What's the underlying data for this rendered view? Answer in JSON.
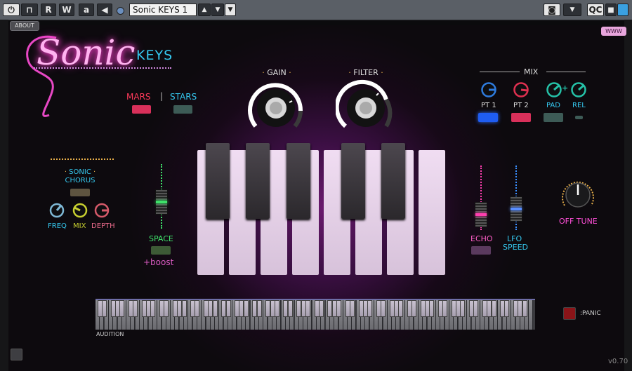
{
  "toolbar": {
    "r_label": "R",
    "w_label": "W",
    "a_label": "a",
    "preset_name": "Sonic KEYS 1",
    "qc_label": "QC"
  },
  "header": {
    "about_label": "ABOUT",
    "www_label": "WWW",
    "brand_script": "Sonic",
    "brand_keys": "KEYS"
  },
  "mode": {
    "mars": "MARS",
    "separator": "|",
    "stars": "STARS"
  },
  "knobs": {
    "gain": "GAIN",
    "filter": "FILTER"
  },
  "mix": {
    "title": "MIX",
    "pt1": "PT 1",
    "pt2": "PT 2",
    "pad": "PAD",
    "rel": "REL",
    "plus": "+"
  },
  "chorus": {
    "title_line1": "SONIC",
    "title_line2": "CHORUS",
    "freq": "FREQ",
    "mix": "MIX",
    "depth": "DEPTH"
  },
  "space": {
    "label": "SPACE",
    "boost": "+boost"
  },
  "echo": {
    "label": "ECHO"
  },
  "lfo": {
    "line1": "LFO",
    "line2": "SPEED"
  },
  "offtune": {
    "label": "OFF TUNE"
  },
  "footer": {
    "audition": "AUDITION",
    "panic": ":PANIC",
    "version": "v0.70"
  },
  "colors": {
    "neon_pink": "#ff4fd8",
    "cyan": "#35c9f0",
    "mars_red": "#ff3a5a",
    "green": "#3fe06a",
    "gold": "#e8b04a"
  }
}
